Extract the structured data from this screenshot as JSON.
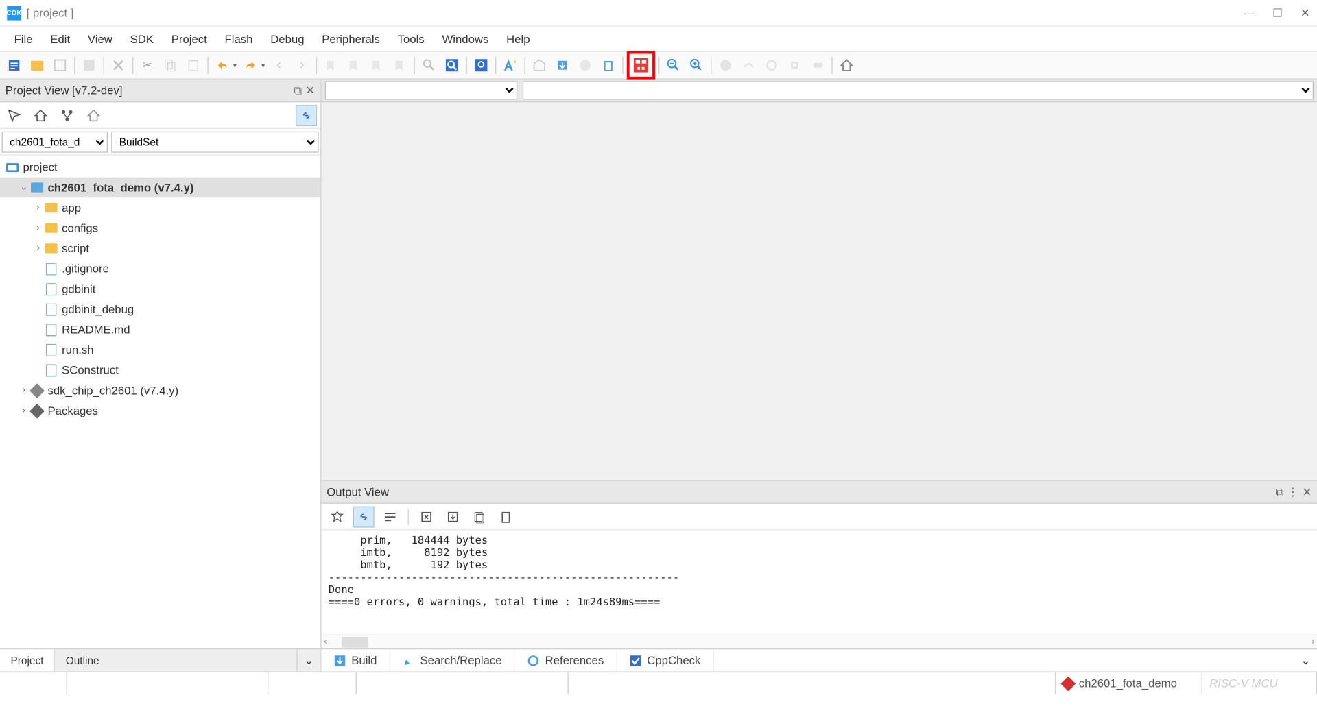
{
  "window": {
    "app_badge": "CDK",
    "title": "[ project ]"
  },
  "menu": [
    "File",
    "Edit",
    "View",
    "SDK",
    "Project",
    "Flash",
    "Debug",
    "Peripherals",
    "Tools",
    "Windows",
    "Help"
  ],
  "project_view": {
    "title": "Project View [v7.2-dev]",
    "selector_project": "ch2601_fota_d",
    "selector_buildset": "BuildSet",
    "root": "project",
    "nodes": {
      "demo": "ch2601_fota_demo (v7.4.y)",
      "app": "app",
      "configs": "configs",
      "script": "script",
      "gitignore": ".gitignore",
      "gdbinit": "gdbinit",
      "gdbinit_debug": "gdbinit_debug",
      "readme": "README.md",
      "runsh": "run.sh",
      "sconstruct": "SConstruct",
      "sdk_chip": "sdk_chip_ch2601 (v7.4.y)",
      "packages": "Packages"
    },
    "tabs": {
      "project": "Project",
      "outline": "Outline"
    }
  },
  "output_view": {
    "title": "Output View",
    "text": "     prim,   184444 bytes\n     imtb,     8192 bytes\n     bmtb,      192 bytes\n-------------------------------------------------------\nDone\n====0 errors, 0 warnings, total time : 1m24s89ms===="
  },
  "bottom_tabs": {
    "build": "Build",
    "search": "Search/Replace",
    "references": "References",
    "cppcheck": "CppCheck"
  },
  "statusbar": {
    "project": "ch2601_fota_demo",
    "watermark": "RISC-V MCU"
  }
}
